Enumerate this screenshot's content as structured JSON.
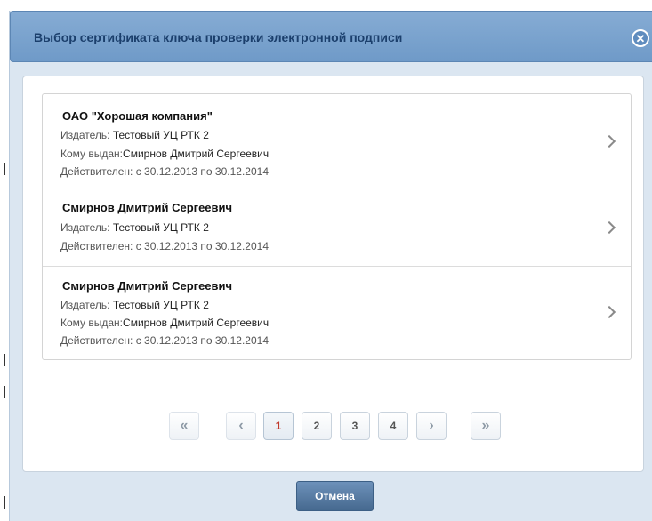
{
  "dialog": {
    "title": "Выбор сертификата ключа проверки электронной подписи",
    "close_icon": "close-circle-icon",
    "cancel_label": "Отмена"
  },
  "certificates": [
    {
      "name": "ОАО \"Хорошая компания\"",
      "issuer_label": "Издатель:",
      "issuer": "Тестовый УЦ РТК 2",
      "issued_to_label": "Кому выдан:",
      "issued_to": "Смирнов Дмитрий Сергеевич",
      "valid_label": "Действителен:",
      "valid": "с 30.12.2013 по 30.12.2014"
    },
    {
      "name": "Смирнов Дмитрий Сергеевич",
      "issuer_label": "Издатель:",
      "issuer": "Тестовый УЦ РТК 2",
      "valid_label": "Действителен:",
      "valid": "с 30.12.2013 по 30.12.2014"
    },
    {
      "name": "Смирнов Дмитрий Сергеевич",
      "issuer_label": "Издатель:",
      "issuer": "Тестовый УЦ РТК 2",
      "issued_to_label": "Кому выдан:",
      "issued_to": "Смирнов Дмитрий Сергеевич",
      "valid_label": "Действителен:",
      "valid": "с 30.12.2013 по 30.12.2014"
    }
  ],
  "pagination": {
    "first": "«",
    "prev": "‹",
    "pages": [
      "1",
      "2",
      "3",
      "4"
    ],
    "current": "1",
    "next": "›",
    "last": "»"
  },
  "colors": {
    "title_bar": "#7aa3cf",
    "title_text": "#1b3f6c",
    "active_page": "#c0392b",
    "cancel_button": "#5a7ea6"
  }
}
